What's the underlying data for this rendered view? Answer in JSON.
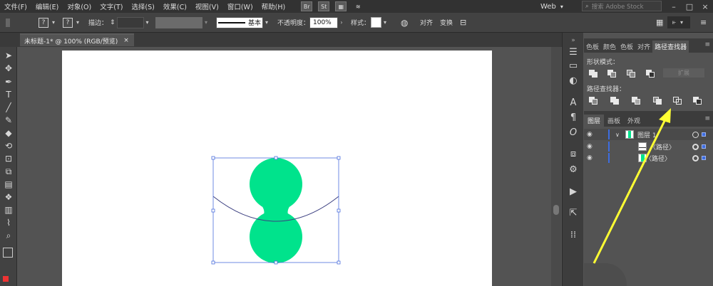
{
  "menubar": {
    "items": [
      "文件(F)",
      "编辑(E)",
      "对象(O)",
      "文字(T)",
      "选择(S)",
      "效果(C)",
      "视图(V)",
      "窗口(W)",
      "帮助(H)"
    ],
    "apps": [
      "Br",
      "St"
    ],
    "workspace": "Web",
    "search_placeholder": "搜索 Adobe Stock"
  },
  "controlbar": {
    "stroke_label": "描边：",
    "stroke_style": "基本",
    "opacity_label": "不透明度：",
    "opacity_value": "100%",
    "style_label": "样式：",
    "align_label": "对齐",
    "transform_label": "变换"
  },
  "document": {
    "tab_title": "未标题-1* @ 100% (RGB/预览)"
  },
  "colors": {
    "shape_fill": "#00e38c",
    "curve_stroke": "#3b3f80",
    "selection": "#4c6fdc",
    "annotation_arrow": "#ffff33"
  },
  "panels": {
    "top_tabs": [
      "色板",
      "颜色",
      "色板",
      "对齐",
      "路径查找器"
    ],
    "shape_modes_label": "形状模式：",
    "expand_label": "扩展",
    "pathfinder_label": "路径查找器：",
    "layers_tabs": [
      "图层",
      "画板",
      "外观"
    ],
    "layers": [
      {
        "name": "图层 1",
        "indent": 0
      },
      {
        "name": "〈路径〉",
        "indent": 1
      },
      {
        "name": "〈路径〉",
        "indent": 1
      }
    ]
  },
  "icons": {
    "tools": [
      "selection-tool-icon",
      "direct-selection-tool-icon",
      "pen-tool-icon",
      "type-tool-icon",
      "line-tool-icon",
      "paintbrush-tool-icon",
      "eraser-tool-icon",
      "rotate-tool-icon",
      "free-transform-tool-icon",
      "shape-builder-tool-icon",
      "gradient-tool-icon",
      "symbol-sprayer-tool-icon",
      "column-graph-tool-icon",
      "eyedropper-tool-icon",
      "zoom-tool-icon"
    ]
  }
}
